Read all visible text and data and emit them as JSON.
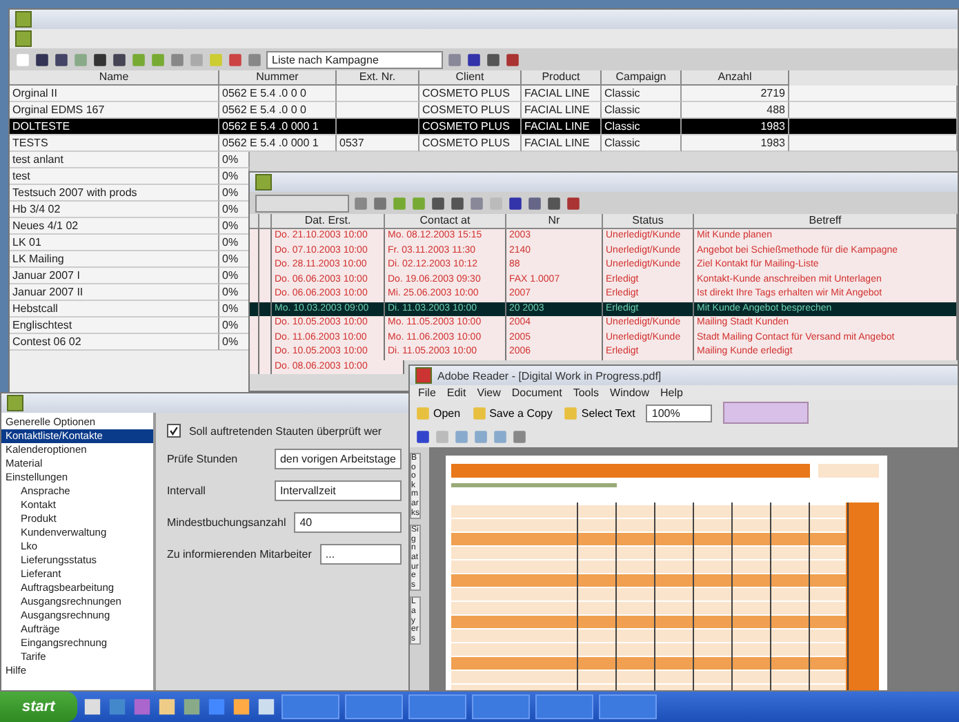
{
  "main_window": {
    "toolbar": {
      "view_select": "Liste nach Kampagne"
    },
    "table": {
      "columns": [
        "Name",
        "Nummer",
        "Ext. Nr.",
        "Client",
        "Product",
        "Campaign",
        "Anzahl"
      ],
      "rows": [
        {
          "name": "Orginal II",
          "number": "0562 E 5.4 .0 0 0",
          "ext": "",
          "client": "COSMETO PLUS",
          "product": "FACIAL LINE",
          "campaign": "Classic",
          "count": "2719",
          "selected": false
        },
        {
          "name": "Orginal EDMS 167",
          "number": "0562 E 5.4 .0 0 0",
          "ext": "",
          "client": "COSMETO PLUS",
          "product": "FACIAL LINE",
          "campaign": "Classic",
          "count": "488",
          "selected": false
        },
        {
          "name": "DOLTESTE",
          "number": "0562 E 5.4 .0 000 1",
          "ext": "",
          "client": "COSMETO PLUS",
          "product": "FACIAL LINE",
          "campaign": "Classic",
          "count": "1983",
          "selected": true
        },
        {
          "name": "TESTS",
          "number": "0562 E 5.4 .0 000 1",
          "ext": "0537",
          "client": "COSMETO PLUS",
          "product": "FACIAL LINE",
          "campaign": "Classic",
          "count": "1983",
          "selected": false
        }
      ],
      "more_rows": [
        {
          "name": "test anlant",
          "share": "0%"
        },
        {
          "name": "test",
          "share": "0%"
        },
        {
          "name": "Testsuch 2007 with prods",
          "share": "0%"
        },
        {
          "name": "Hb 3/4 02",
          "share": "0%"
        },
        {
          "name": "Neues 4/1 02",
          "share": "0%"
        },
        {
          "name": "LK 01",
          "share": "0%"
        },
        {
          "name": "LK Mailing",
          "share": "0%"
        },
        {
          "name": "Januar 2007 I",
          "share": "0%"
        },
        {
          "name": "Januar 2007 II",
          "share": "0%"
        },
        {
          "name": "Hebstcall",
          "share": "0%"
        },
        {
          "name": "Englischtest",
          "share": "0%"
        },
        {
          "name": "Contest 06 02",
          "share": "0%"
        }
      ]
    }
  },
  "contacts_window": {
    "columns": [
      "Dat. Erst.",
      "Contact at",
      "Nr",
      "Status",
      "Betreff"
    ],
    "rows": [
      {
        "created": "Do. 21.10.2003 10:00",
        "contact_at": "Mo. 08.12.2003 15:15",
        "nr": "2003",
        "status": "Unerledigt/Kunde",
        "subject": "Mit Kunde planen",
        "selected": false
      },
      {
        "created": "Do. 07.10.2003 10:00",
        "contact_at": "Fr. 03.11.2003 11:30",
        "nr": "2140",
        "status": "Unerledigt/Kunde",
        "subject": "Angebot bei Schießmethode für die Kampagne",
        "selected": false
      },
      {
        "created": "Do. 28.11.2003 10:00",
        "contact_at": "Di. 02.12.2003 10:12",
        "nr": "88",
        "status": "Unerledigt/Kunde",
        "subject": "Ziel Kontakt für Mailing-Liste",
        "selected": false
      },
      {
        "created": "Do. 06.06.2003 10:00",
        "contact_at": "Do. 19.06.2003 09:30",
        "nr": "FAX 1.0007",
        "status": "Erledigt",
        "subject": "Kontakt-Kunde anschreiben mit Unterlagen",
        "selected": false
      },
      {
        "created": "Do. 06.06.2003 10:00",
        "contact_at": "Mi. 25.06.2003 10:00",
        "nr": "2007",
        "status": "Erledigt",
        "subject": "Ist direkt Ihre Tags erhalten wir Mit Angebot",
        "selected": false
      },
      {
        "created": "Mo. 10.03.2003 09:00",
        "contact_at": "Di. 11.03.2003 10:00",
        "nr": "20 2003",
        "status": "Erledigt",
        "subject": "Mit Kunde Angebot besprechen",
        "selected": true
      },
      {
        "created": "Do. 10.05.2003 10:00",
        "contact_at": "Mo. 11.05.2003 10:00",
        "nr": "2004",
        "status": "Unerledigt/Kunde",
        "subject": "Mailing Stadt Kunden",
        "selected": false
      },
      {
        "created": "Do. 11.06.2003 10:00",
        "contact_at": "Mo. 11.06.2003 10:00",
        "nr": "2005",
        "status": "Unerledigt/Kunde",
        "subject": "Stadt Mailing Contact für Versand mit Angebot",
        "selected": false
      },
      {
        "created": "Do. 10.05.2003 10:00",
        "contact_at": "Di. 11.05.2003 10:00",
        "nr": "2006",
        "status": "Erledigt",
        "subject": "Mailing Kunde erledigt",
        "selected": false
      },
      {
        "created": "Do. 08.06.2003 10:00",
        "contact_at": "",
        "nr": "",
        "status": "",
        "subject": "",
        "selected": false
      }
    ]
  },
  "options_window": {
    "tree": [
      {
        "label": "Generelle Optionen",
        "selected": false
      },
      {
        "label": "Kontaktliste/Kontakte",
        "selected": true
      },
      {
        "label": "Kalenderoptionen",
        "selected": false
      },
      {
        "label": "Material",
        "selected": false
      },
      {
        "label": "Einstellungen",
        "selected": false,
        "children": [
          {
            "label": "Ansprache",
            "selected": false
          },
          {
            "label": "Kontakt",
            "selected": false
          },
          {
            "label": "Produkt",
            "selected": false
          },
          {
            "label": "Kundenverwaltung",
            "selected": false
          },
          {
            "label": "Lko",
            "selected": false
          },
          {
            "label": "Lieferungsstatus",
            "selected": false
          },
          {
            "label": "Lieferant",
            "selected": false
          },
          {
            "label": "Auftragsbearbeitung",
            "selected": false
          },
          {
            "label": "Ausgangsrechnungen",
            "selected": false
          },
          {
            "label": "Ausgangsrechnung",
            "selected": false
          },
          {
            "label": "Aufträge",
            "selected": false
          },
          {
            "label": "Eingangsrechnung",
            "selected": false
          },
          {
            "label": "Tarife",
            "selected": false
          }
        ]
      },
      {
        "label": "Hilfe",
        "selected": false
      }
    ],
    "form": {
      "check_label": "Soll auftretenden Stauten überprüft wer",
      "checked": true,
      "fields": [
        {
          "label": "Prüfe Stunden",
          "value": "den vorigen Arbeitstage"
        },
        {
          "label": "Intervall",
          "value": "Intervallzeit"
        },
        {
          "label": "Mindestbuchungsanzahl",
          "value": "40"
        },
        {
          "label": "Zu informierenden Mitarbeiter",
          "value": "..."
        }
      ]
    }
  },
  "reader_window": {
    "title": "Adobe Reader - [Digital Work in Progress.pdf]",
    "menu": [
      "File",
      "Edit",
      "View",
      "Document",
      "Tools",
      "Window",
      "Help"
    ],
    "toolbar": [
      {
        "kind": "button",
        "label": "Open"
      },
      {
        "kind": "button",
        "label": "Save a Copy"
      },
      {
        "kind": "button",
        "label": "Select Text"
      },
      {
        "kind": "zoom",
        "label": "100%"
      }
    ],
    "side_tabs": [
      "Bookmarks",
      "Signatures",
      "Layers"
    ]
  },
  "taskbar": {
    "start": "start"
  }
}
